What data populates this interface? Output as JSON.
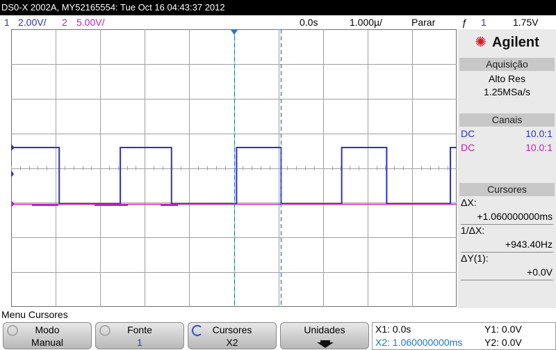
{
  "title_bar": "DS0-X 2002A, MY52165554: Tue Oct 16 04:43:37 2012",
  "channel_bar": {
    "ch1_num": "1",
    "ch1_scale": "2.00V/",
    "ch2_num": "2",
    "ch2_scale": "5.00V/",
    "delay": "0.0s",
    "timebase": "1.000µ/",
    "run_state": "Parar",
    "trigger_icon": "ƒ",
    "trigger_ch": "1",
    "trigger_level": "1.75V"
  },
  "side_panel": {
    "brand": "Agilent",
    "brand_icon": "agilent-spark-icon",
    "acquisition_header": "Aquisição",
    "acquisition_mode": "Alto Res",
    "sample_rate": "1.25MSa/s",
    "channels_header": "Canais",
    "channels": [
      {
        "coupling": "DC",
        "probe": "10.0:1",
        "color": "#2b31c9"
      },
      {
        "coupling": "DC",
        "probe": "10.0:1",
        "color": "#c020c0"
      }
    ],
    "cursors_header": "Cursores",
    "dx_label": "ΔX:",
    "dx_value": "+1.060000000ms",
    "inv_dx_label": "1/ΔX:",
    "inv_dx_value": "+943.40Hz",
    "dy_label": "ΔY(1):",
    "dy_value": "+0.0V"
  },
  "menu_title": "Menu Cursores",
  "softkeys": [
    {
      "label": "Modo",
      "value": "Manual",
      "icon": "rotary-knob-icon"
    },
    {
      "label": "Fonte",
      "value": "1",
      "icon": "rotary-knob-icon"
    },
    {
      "label": "Cursores",
      "value": "X2",
      "icon": "rotary-knob-icon"
    },
    {
      "label": "Unidades",
      "value": "",
      "icon": "down-arrow-icon"
    }
  ],
  "readout": {
    "x1": "X1: 0.0s",
    "x2": "X2: 1.060000000ms",
    "y1": "Y1: 0.0V",
    "y2": "Y2: 0.0V"
  },
  "colors": {
    "ch1": "#2b31c9",
    "ch2": "#c020c0",
    "cursor": "#1e78c8",
    "grid": "#a0a0a0",
    "accent": "#d0202a"
  },
  "waveform": {
    "high_segments_fraction": [
      [
        0.0,
        0.108
      ],
      [
        0.245,
        0.36
      ],
      [
        0.506,
        0.606
      ],
      [
        0.742,
        0.843
      ],
      [
        0.986,
        1.0
      ]
    ]
  }
}
